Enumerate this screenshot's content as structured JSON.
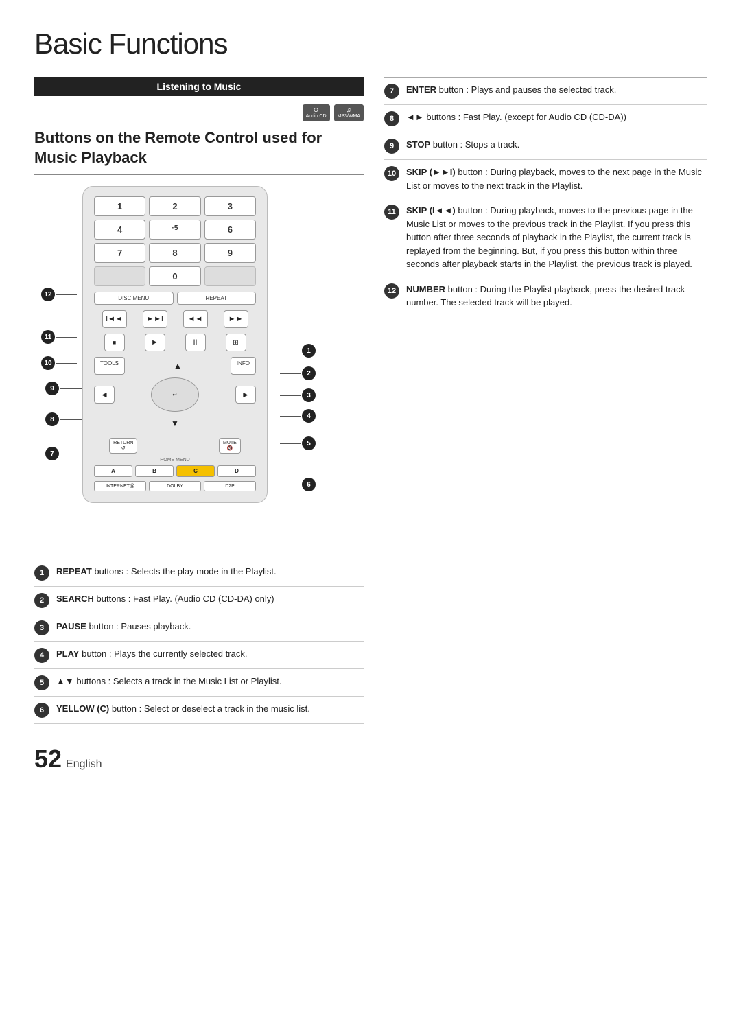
{
  "page": {
    "title": "Basic Functions",
    "footer_number": "52",
    "footer_lang": "English"
  },
  "section": {
    "header": "Listening to Music",
    "subtitle": "Buttons on the Remote Control used for Music Playback"
  },
  "media_badges": [
    {
      "line1": "Audio CD",
      "icon": "cd"
    },
    {
      "line1": "MP3/WMA",
      "icon": "music"
    }
  ],
  "right_entries": [
    {
      "num": "7",
      "bold": "ENTER",
      "text": " button : Plays and pauses the selected track."
    },
    {
      "num": "8",
      "bold": "◄►",
      "text": " buttons : Fast Play. (except for Audio CD (CD-DA))"
    },
    {
      "num": "9",
      "bold": "STOP",
      "text": " button : Stops a track."
    },
    {
      "num": "10",
      "bold": "SKIP (►►I)",
      "text": " button : During playback, moves to the next page in the Music List or moves to the next track in the Playlist."
    },
    {
      "num": "11",
      "bold": "SKIP (I◄◄)",
      "text": " button : During playback, moves to the previous page in the Music List or moves to the previous track in the Playlist. If you press this button after three seconds of playback in the Playlist, the current track is replayed from the beginning. But, if you press this button within three seconds after playback starts in the Playlist, the previous track is played."
    },
    {
      "num": "12",
      "bold": "NUMBER",
      "text": " button : During the Playlist playback, press the desired track number. The selected track will be played."
    }
  ],
  "bottom_entries": [
    {
      "num": "1",
      "bold": "REPEAT",
      "text": " buttons : Selects the play mode in the Playlist."
    },
    {
      "num": "2",
      "bold": "SEARCH",
      "text": " buttons : Fast Play. (Audio CD (CD-DA) only)"
    },
    {
      "num": "3",
      "bold": "PAUSE",
      "text": " button : Pauses playback."
    },
    {
      "num": "4",
      "bold": "PLAY",
      "text": " button : Plays the currently selected track."
    },
    {
      "num": "5",
      "bold": "▲▼",
      "text": " buttons : Selects a track in the Music List or Playlist."
    },
    {
      "num": "6",
      "bold": "YELLOW (C)",
      "text": " button : Select or deselect a track in the music list."
    }
  ],
  "remote": {
    "numpad": [
      "1",
      "2",
      "3",
      "4",
      "·5",
      "6",
      "7",
      "8",
      "9",
      "",
      "0",
      ""
    ],
    "func_left": "DISC MENU",
    "func_right": "REPEAT",
    "transport": [
      "I◄◄",
      "►►I",
      "◄◄",
      "►►"
    ],
    "playback": [
      "■",
      "►",
      "II",
      "⊞"
    ],
    "nav_top_left": "TOOLS",
    "nav_top_right": "INFO",
    "nav_enter": "ENTER",
    "bottom_left": "RETURN",
    "bottom_right": "MUTE",
    "abc": [
      "A",
      "B",
      "C",
      "D"
    ],
    "bottom_bar": [
      "INTERNET@",
      "DOLBY",
      "D2P"
    ]
  },
  "annotations": {
    "left_side": [
      {
        "num": "12",
        "top_pct": 38
      },
      {
        "num": "11",
        "top_pct": 50
      },
      {
        "num": "10",
        "top_pct": 55
      },
      {
        "num": "9",
        "top_pct": 60
      },
      {
        "num": "8",
        "top_pct": 68
      },
      {
        "num": "7",
        "top_pct": 75
      }
    ],
    "right_side": [
      {
        "num": "1",
        "top_pct": 50
      },
      {
        "num": "2",
        "top_pct": 55
      },
      {
        "num": "3",
        "top_pct": 60
      },
      {
        "num": "4",
        "top_pct": 65
      },
      {
        "num": "5",
        "top_pct": 73
      },
      {
        "num": "6",
        "top_pct": 80
      }
    ]
  }
}
